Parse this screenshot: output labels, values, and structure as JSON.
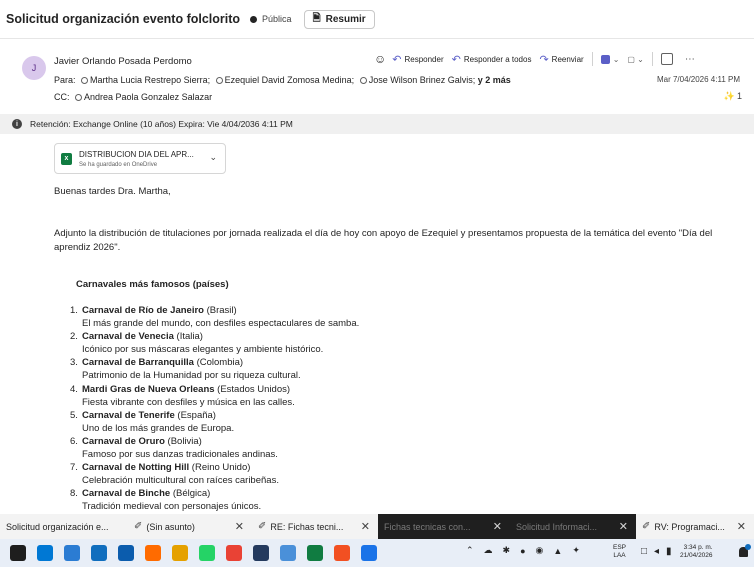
{
  "subject": {
    "title": "Solicitud organización evento folclorito",
    "visibility": "Pública",
    "summarize_label": "Resumir"
  },
  "message": {
    "avatar_initial": "J",
    "sender": "Javier Orlando Posada Perdomo",
    "to_label": "Para:",
    "recipients": [
      "Martha Lucia Restrepo Sierra;",
      "Ezequiel David Zomosa Medina;",
      "Jose Wilson Brinez Galvis;"
    ],
    "more_recipients": "y 2 más",
    "cc_label": "CC:",
    "cc": "Andrea Paola Gonzalez Salazar",
    "date": "Mar 7/04/2026 4:11 PM",
    "reaction_count": "1",
    "actions": {
      "reply": "Responder",
      "reply_all": "Responder a todos",
      "forward": "Reenviar"
    }
  },
  "retention": "Retención: Exchange Online (10 años) Expira: Vie 4/04/2036 4:11 PM",
  "attachment": {
    "name": "DISTRIBUCION DIA DEL APR...",
    "status": "Se ha guardado en OneDrive"
  },
  "body": {
    "greeting": "Buenas tardes Dra. Martha,",
    "paragraph": "Adjunto la distribución de titulaciones por jornada realizada el día de hoy con apoyo de Ezequiel y presentamos propuesta de la temática del evento \"Día del aprendiz 2026\".",
    "list_title": "Carnavales más famosos (países)",
    "carnivals": [
      {
        "num": "1.",
        "name": "Carnaval de Río de Janeiro",
        "country": "(Brasil)",
        "desc": "El más grande del mundo, con desfiles espectaculares de samba."
      },
      {
        "num": "2.",
        "name": "Carnaval de Venecia",
        "country": "(Italia)",
        "desc": "Icónico por sus máscaras elegantes y ambiente histórico."
      },
      {
        "num": "3.",
        "name": "Carnaval de Barranquilla",
        "country": "(Colombia)",
        "desc": "Patrimonio de la Humanidad por su riqueza cultural."
      },
      {
        "num": "4.",
        "name": "Mardi Gras de Nueva Orleans",
        "country": "(Estados Unidos)",
        "desc": "Fiesta vibrante con desfiles y música en las calles."
      },
      {
        "num": "5.",
        "name": "Carnaval de Tenerife",
        "country": "(España)",
        "desc": "Uno de los más grandes de Europa."
      },
      {
        "num": "6.",
        "name": "Carnaval de Oruro",
        "country": "(Bolivia)",
        "desc": "Famoso por sus danzas tradicionales andinas."
      },
      {
        "num": "7.",
        "name": "Carnaval de Notting Hill",
        "country": "(Reino Unido)",
        "desc": "Celebración multicultural con raíces caribeñas."
      },
      {
        "num": "8.",
        "name": "Carnaval de Binche",
        "country": "(Bélgica)",
        "desc": "Tradición medieval con personajes únicos."
      }
    ]
  },
  "tabs": [
    {
      "label": "Solicitud organización e...",
      "icon": "",
      "dark": false
    },
    {
      "label": "(Sin asunto)",
      "icon": "pencil-icon",
      "dark": false
    },
    {
      "label": "RE: Fichas tecni...",
      "icon": "pencil-icon",
      "dark": false
    },
    {
      "label": "Fichas tecnicas con...",
      "icon": "",
      "dark": true
    },
    {
      "label": "Solicitud Informaci...",
      "icon": "",
      "dark": true
    },
    {
      "label": "RV: Programaci...",
      "icon": "pencil-icon",
      "dark": false
    }
  ],
  "taskbar": {
    "language": "ESP",
    "language_sub": "LAA",
    "time": "3:34 p. m.",
    "date": "21/04/2026",
    "app_icon_colors": [
      "#1e1e1e",
      "#0078d4",
      "#2b7cd3",
      "#106ebe",
      "#0b5cad",
      "#ff6b00",
      "#e5a100",
      "#25d366",
      "#e94235",
      "#243a5e",
      "#4a90d9",
      "#107c41",
      "#f25022",
      "#1a73e8"
    ]
  }
}
